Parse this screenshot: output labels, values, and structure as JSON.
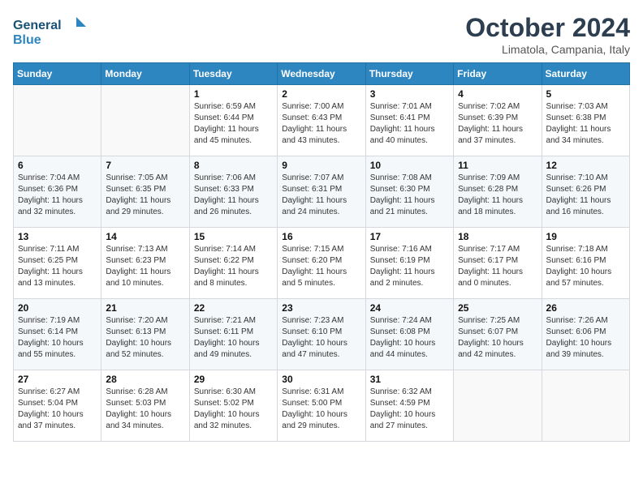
{
  "header": {
    "logo_line1": "General",
    "logo_line2": "Blue",
    "month": "October 2024",
    "location": "Limatola, Campania, Italy"
  },
  "weekdays": [
    "Sunday",
    "Monday",
    "Tuesday",
    "Wednesday",
    "Thursday",
    "Friday",
    "Saturday"
  ],
  "weeks": [
    [
      {
        "day": "",
        "info": ""
      },
      {
        "day": "",
        "info": ""
      },
      {
        "day": "1",
        "info": "Sunrise: 6:59 AM\nSunset: 6:44 PM\nDaylight: 11 hours and 45 minutes."
      },
      {
        "day": "2",
        "info": "Sunrise: 7:00 AM\nSunset: 6:43 PM\nDaylight: 11 hours and 43 minutes."
      },
      {
        "day": "3",
        "info": "Sunrise: 7:01 AM\nSunset: 6:41 PM\nDaylight: 11 hours and 40 minutes."
      },
      {
        "day": "4",
        "info": "Sunrise: 7:02 AM\nSunset: 6:39 PM\nDaylight: 11 hours and 37 minutes."
      },
      {
        "day": "5",
        "info": "Sunrise: 7:03 AM\nSunset: 6:38 PM\nDaylight: 11 hours and 34 minutes."
      }
    ],
    [
      {
        "day": "6",
        "info": "Sunrise: 7:04 AM\nSunset: 6:36 PM\nDaylight: 11 hours and 32 minutes."
      },
      {
        "day": "7",
        "info": "Sunrise: 7:05 AM\nSunset: 6:35 PM\nDaylight: 11 hours and 29 minutes."
      },
      {
        "day": "8",
        "info": "Sunrise: 7:06 AM\nSunset: 6:33 PM\nDaylight: 11 hours and 26 minutes."
      },
      {
        "day": "9",
        "info": "Sunrise: 7:07 AM\nSunset: 6:31 PM\nDaylight: 11 hours and 24 minutes."
      },
      {
        "day": "10",
        "info": "Sunrise: 7:08 AM\nSunset: 6:30 PM\nDaylight: 11 hours and 21 minutes."
      },
      {
        "day": "11",
        "info": "Sunrise: 7:09 AM\nSunset: 6:28 PM\nDaylight: 11 hours and 18 minutes."
      },
      {
        "day": "12",
        "info": "Sunrise: 7:10 AM\nSunset: 6:26 PM\nDaylight: 11 hours and 16 minutes."
      }
    ],
    [
      {
        "day": "13",
        "info": "Sunrise: 7:11 AM\nSunset: 6:25 PM\nDaylight: 11 hours and 13 minutes."
      },
      {
        "day": "14",
        "info": "Sunrise: 7:13 AM\nSunset: 6:23 PM\nDaylight: 11 hours and 10 minutes."
      },
      {
        "day": "15",
        "info": "Sunrise: 7:14 AM\nSunset: 6:22 PM\nDaylight: 11 hours and 8 minutes."
      },
      {
        "day": "16",
        "info": "Sunrise: 7:15 AM\nSunset: 6:20 PM\nDaylight: 11 hours and 5 minutes."
      },
      {
        "day": "17",
        "info": "Sunrise: 7:16 AM\nSunset: 6:19 PM\nDaylight: 11 hours and 2 minutes."
      },
      {
        "day": "18",
        "info": "Sunrise: 7:17 AM\nSunset: 6:17 PM\nDaylight: 11 hours and 0 minutes."
      },
      {
        "day": "19",
        "info": "Sunrise: 7:18 AM\nSunset: 6:16 PM\nDaylight: 10 hours and 57 minutes."
      }
    ],
    [
      {
        "day": "20",
        "info": "Sunrise: 7:19 AM\nSunset: 6:14 PM\nDaylight: 10 hours and 55 minutes."
      },
      {
        "day": "21",
        "info": "Sunrise: 7:20 AM\nSunset: 6:13 PM\nDaylight: 10 hours and 52 minutes."
      },
      {
        "day": "22",
        "info": "Sunrise: 7:21 AM\nSunset: 6:11 PM\nDaylight: 10 hours and 49 minutes."
      },
      {
        "day": "23",
        "info": "Sunrise: 7:23 AM\nSunset: 6:10 PM\nDaylight: 10 hours and 47 minutes."
      },
      {
        "day": "24",
        "info": "Sunrise: 7:24 AM\nSunset: 6:08 PM\nDaylight: 10 hours and 44 minutes."
      },
      {
        "day": "25",
        "info": "Sunrise: 7:25 AM\nSunset: 6:07 PM\nDaylight: 10 hours and 42 minutes."
      },
      {
        "day": "26",
        "info": "Sunrise: 7:26 AM\nSunset: 6:06 PM\nDaylight: 10 hours and 39 minutes."
      }
    ],
    [
      {
        "day": "27",
        "info": "Sunrise: 6:27 AM\nSunset: 5:04 PM\nDaylight: 10 hours and 37 minutes."
      },
      {
        "day": "28",
        "info": "Sunrise: 6:28 AM\nSunset: 5:03 PM\nDaylight: 10 hours and 34 minutes."
      },
      {
        "day": "29",
        "info": "Sunrise: 6:30 AM\nSunset: 5:02 PM\nDaylight: 10 hours and 32 minutes."
      },
      {
        "day": "30",
        "info": "Sunrise: 6:31 AM\nSunset: 5:00 PM\nDaylight: 10 hours and 29 minutes."
      },
      {
        "day": "31",
        "info": "Sunrise: 6:32 AM\nSunset: 4:59 PM\nDaylight: 10 hours and 27 minutes."
      },
      {
        "day": "",
        "info": ""
      },
      {
        "day": "",
        "info": ""
      }
    ]
  ]
}
